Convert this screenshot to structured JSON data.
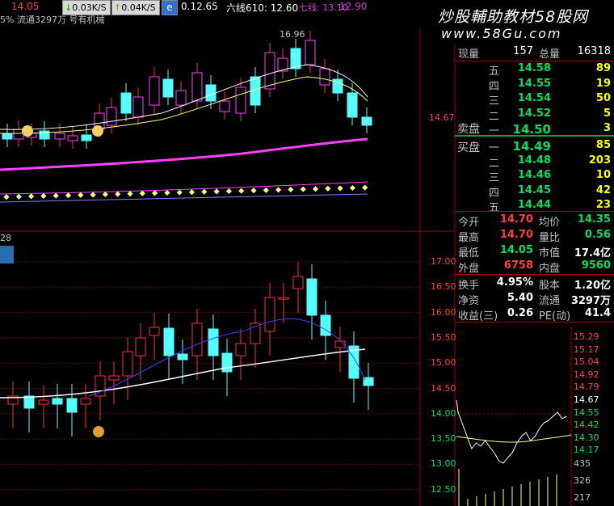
{
  "toolbar": {
    "left_price": "14.05",
    "speed_down": "0.03K/S",
    "speed_up": "0.04K/S",
    "ma5_value": "0.12.65",
    "ma10_label": "六线610: 12.60",
    "ma_tail": "七线: 13.10",
    "ma_tail2": "12.90",
    "top_row2": "5% 流通3297万 号有机械",
    "watermark": "炒股輔助教材58股网",
    "watermark_url": "www.58Gu.com"
  },
  "main_chart": {
    "price_label": "14.67",
    "max_label": "16.96"
  },
  "lower_chart": {
    "top_label": "28",
    "axis_ticks": [
      "17.00",
      "16.50",
      "16.00",
      "15.50",
      "15.00",
      "14.50",
      "14.00",
      "13.50",
      "13.00",
      "12.50"
    ]
  },
  "quote": {
    "now_label": "现量",
    "now_value": "157",
    "total_label": "总量",
    "total_value": "16318",
    "sell_label": "卖盘",
    "buy_label": "买盘",
    "sell": [
      {
        "level": "五",
        "price": "14.58",
        "vol": "89"
      },
      {
        "level": "四",
        "price": "14.55",
        "vol": "19"
      },
      {
        "level": "三",
        "price": "14.54",
        "vol": "50"
      },
      {
        "level": "二",
        "price": "14.52",
        "vol": "5"
      },
      {
        "level": "一",
        "price": "14.50",
        "vol": "3"
      }
    ],
    "buy": [
      {
        "level": "一",
        "price": "14.49",
        "vol": "85"
      },
      {
        "level": "二",
        "price": "14.48",
        "vol": "203"
      },
      {
        "level": "三",
        "price": "14.46",
        "vol": "10"
      },
      {
        "level": "四",
        "price": "14.45",
        "vol": "42"
      },
      {
        "level": "五",
        "price": "14.44",
        "vol": "23"
      }
    ],
    "stats": [
      {
        "k1": "今开",
        "v1": "14.70",
        "k2": "均价",
        "v2": "14.35"
      },
      {
        "k1": "最高",
        "v1": "14.70",
        "k2": "量比",
        "v2": "0.56"
      },
      {
        "k1": "最低",
        "v1": "14.05",
        "k2": "市值",
        "v2": "17.4亿"
      },
      {
        "k1": "外盘",
        "v1": "6758",
        "k2": "内盘",
        "v2": "9560"
      }
    ],
    "stats2": [
      {
        "k1": "换手",
        "v1": "4.95%",
        "k2": "股本",
        "v2": "1.20亿"
      },
      {
        "k1": "净资",
        "v1": "5.40",
        "k2": "流通",
        "v2": "3297万"
      },
      {
        "k1": "收益(三)",
        "v1": "0.26",
        "k2": "PE(动)",
        "v2": "41.4"
      }
    ]
  },
  "mini_chart": {
    "ticks": [
      "15.29",
      "15.17",
      "15.04",
      "14.92",
      "14.79",
      "14.67",
      "14.55",
      "14.42",
      "14.30",
      "14.17",
      "435",
      "326",
      "217"
    ]
  },
  "colors": {
    "up": "#ff3030",
    "down": "#54ffff",
    "frame": "#a00000",
    "magenta": "#ff40ff",
    "yellow": "#ffff00"
  }
}
